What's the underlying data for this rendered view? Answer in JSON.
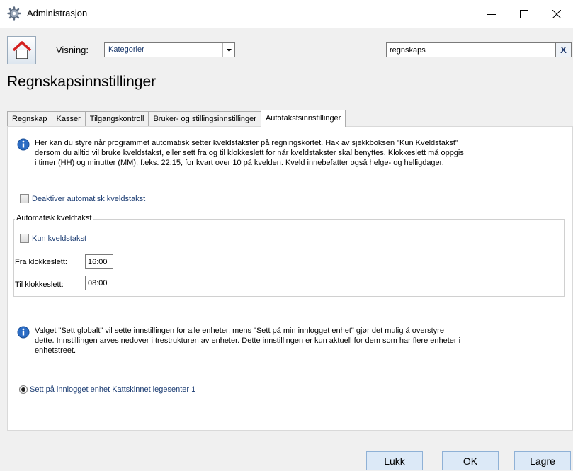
{
  "window": {
    "title": "Administrasjon",
    "icons": {
      "app": "gear-icon",
      "minimize": "minimize-icon",
      "maximize": "maximize-icon",
      "close": "close-icon"
    }
  },
  "toolbar": {
    "home_icon": "home-icon",
    "view_label": "Visning:",
    "view_value": "Kategorier",
    "search_value": "regnskaps",
    "clear_label": "X"
  },
  "page": {
    "title": "Regnskapsinnstillinger"
  },
  "tabs": [
    {
      "label": "Regnskap",
      "active": false
    },
    {
      "label": "Kasser",
      "active": false
    },
    {
      "label": "Tilgangskontroll",
      "active": false
    },
    {
      "label": "Bruker- og stillingsinnstillinger",
      "active": false
    },
    {
      "label": "Autotakstsinnstillinger",
      "active": true
    }
  ],
  "panel": {
    "info1_lines": [
      "Her kan du styre når programmet automatisk setter kveldstakster på regningskortet. Hak av sjekkboksen \"Kun Kveldstakst\"",
      "dersom du alltid vil bruke kveldstakst, eller sett fra og til klokkeslett for når kveldstakster skal benyttes. Klokkeslett må oppgis",
      "i timer (HH) og minutter (MM), f.eks. 22:15, for kvart over 10 på kvelden. Kveld innebefatter også helge- og helligdager."
    ],
    "deactivate_label": "Deaktiver automatisk kveldstakst",
    "group_title": "Automatisk kveldtakst",
    "only_evening_label": "Kun kveldstakst",
    "from_label": "Fra klokkeslett:",
    "from_value": "16:00",
    "to_label": "Til klokkeslett:",
    "to_value": "08:00",
    "info2_lines": [
      "Valget \"Sett globalt\" vil sette innstillingen for alle enheter, mens \"Sett på min innlogget enhet\" gjør det mulig å overstyre",
      "dette. Innstillingen arves nedover i trestrukturen av enheter. Dette innstillingen er kun aktuell for dem som har flere enheter i",
      "enhetstreet."
    ],
    "radio_label": "Sett på innlogget enhet Kattskinnet legesenter 1"
  },
  "footer": {
    "close_label": "Lukk",
    "ok_label": "OK",
    "save_label": "Lagre"
  },
  "colors": {
    "accent": "#1c3d73",
    "button_bg": "#dce9f7",
    "home_roof": "#d42020"
  }
}
